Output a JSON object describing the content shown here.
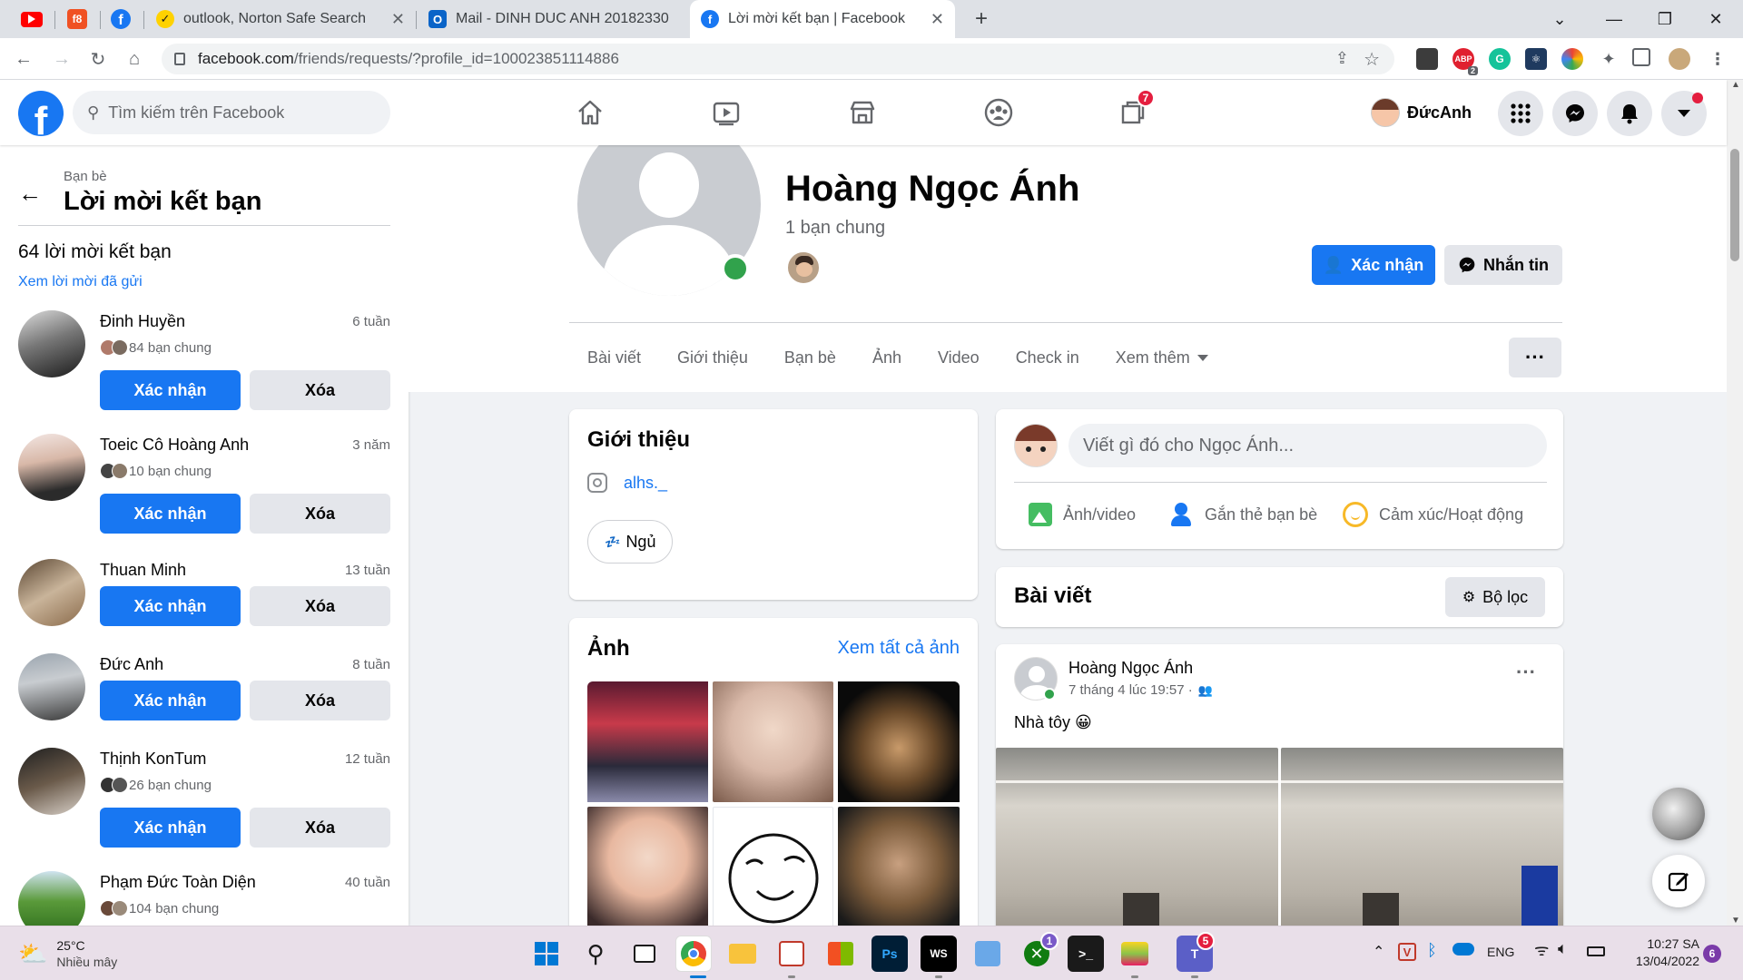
{
  "browser": {
    "tabs": [
      {
        "title": "outlook, Norton Safe Search"
      },
      {
        "title": "Mail - DINH DUC ANH 20182330"
      },
      {
        "title": "Lời mời kết bạn | Facebook"
      }
    ],
    "url_host": "facebook.com",
    "url_path": "/friends/requests/?profile_id=100023851114886",
    "ext_badge": "2"
  },
  "fb": {
    "search_placeholder": "Tìm kiếm trên Facebook",
    "notif_badge": "7",
    "profile_name": "ĐứcAnh"
  },
  "sidebar": {
    "crumb": "Bạn bè",
    "title": "Lời mời kết bạn",
    "count": "64 lời mời kết bạn",
    "sent_link": "Xem lời mời đã gửi",
    "confirm_label": "Xác nhận",
    "delete_label": "Xóa",
    "requests": [
      {
        "name": "Đinh Huyền",
        "time": "6 tuần",
        "mutual": "84 bạn chung"
      },
      {
        "name": "Toeic Cô Hoàng Anh",
        "time": "3 năm",
        "mutual": "10 bạn chung"
      },
      {
        "name": "Thuan Minh",
        "time": "13 tuần",
        "mutual": ""
      },
      {
        "name": "Đức Anh",
        "time": "8 tuần",
        "mutual": ""
      },
      {
        "name": "Thịnh KonTum",
        "time": "12 tuần",
        "mutual": "26 bạn chung"
      },
      {
        "name": "Phạm Đức Toàn Diện",
        "time": "40 tuần",
        "mutual": "104 bạn chung"
      }
    ]
  },
  "profile": {
    "name": "Hoàng Ngọc Ánh",
    "mutual": "1 bạn chung",
    "confirm_button": "Xác nhận",
    "message_button": "Nhắn tin",
    "tabs": [
      "Bài viết",
      "Giới thiệu",
      "Bạn bè",
      "Ảnh",
      "Video",
      "Check in",
      "Xem thêm"
    ],
    "more_button": "···"
  },
  "intro": {
    "title": "Giới thiệu",
    "instagram": "alhs._",
    "status": "Ngủ"
  },
  "photos": {
    "title": "Ảnh",
    "see_all": "Xem tất cả ảnh"
  },
  "composer": {
    "placeholder": "Viết gì đó cho Ngọc Ánh...",
    "actions": [
      "Ảnh/video",
      "Gắn thẻ bạn bè",
      "Cảm xúc/Hoạt động"
    ]
  },
  "posts": {
    "title": "Bài viết",
    "filter": "Bộ lọc",
    "post": {
      "author": "Hoàng Ngọc Ánh",
      "time": "7 tháng 4 lúc 19:57 ·",
      "text": "Nhà tôy 😀",
      "more": "···"
    }
  },
  "taskbar": {
    "weather_temp": "25°C",
    "weather_desc": "Nhiều mây",
    "lang": "ENG",
    "time": "10:27 SA",
    "date": "13/04/2022",
    "notif_count": "6",
    "xbox_badge": "1",
    "teams_badge": "5"
  },
  "colors": {
    "fb_blue": "#1877f2",
    "online_green": "#31a24c",
    "badge_red": "#e41e3f"
  }
}
